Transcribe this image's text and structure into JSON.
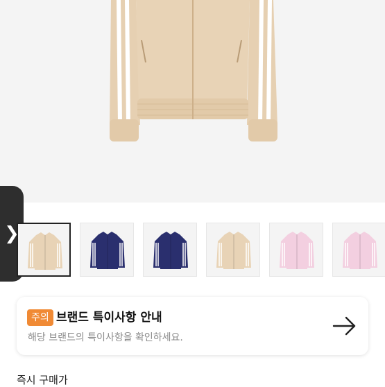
{
  "gallery": {
    "next_icon": "chevron-right-icon",
    "thumbnails": [
      {
        "color": "#e8d3b6",
        "stripe": "#ffffff",
        "selected": true
      },
      {
        "color": "#2a2f6e",
        "stripe": "#ffffff",
        "selected": false
      },
      {
        "color": "#2a2f6e",
        "stripe": "#ffffff",
        "selected": false
      },
      {
        "color": "#e8d3b6",
        "stripe": "#ffffff",
        "selected": false
      },
      {
        "color": "#f3cfe0",
        "stripe": "#ffffff",
        "selected": false
      },
      {
        "color": "#f3cfe0",
        "stripe": "#ffffff",
        "selected": false
      }
    ]
  },
  "notice": {
    "badge": "주의",
    "title": "브랜드 특이사항 안내",
    "subtitle": "해당 브랜드의 특이사항을 확인하세요.",
    "arrow_icon": "arrow-right-icon"
  },
  "section": {
    "label": "즉시 구매가"
  },
  "colors": {
    "accent": "#f08a35",
    "product": "#e8d3b6"
  }
}
